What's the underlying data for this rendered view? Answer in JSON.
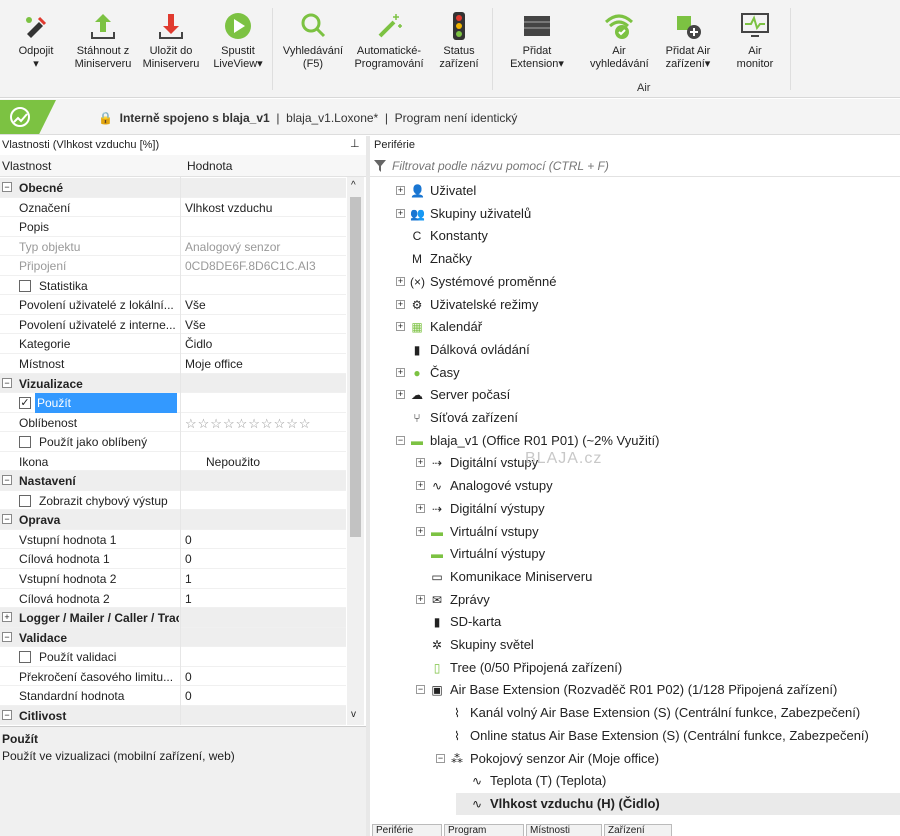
{
  "ribbon": {
    "buttons": [
      {
        "id": "odpojit",
        "label": "Odpojit\n▾",
        "icon": "plug-icon"
      },
      {
        "id": "stahnout",
        "label": "Stáhnout z\nMiniserveru",
        "icon": "upload-icon"
      },
      {
        "id": "ulozit",
        "label": "Uložit do\nMiniserveru",
        "icon": "download-icon"
      },
      {
        "id": "liveview",
        "label": "Spustit\nLiveView▾",
        "icon": "play-icon"
      },
      {
        "id": "vyhledavani",
        "label": "Vyhledávání\n(F5)",
        "icon": "search-icon"
      },
      {
        "id": "autoprog",
        "label": "Automatické-\nProgramování",
        "icon": "magic-wand-icon"
      },
      {
        "id": "status",
        "label": "Status\nzařízení",
        "icon": "traffic-light-icon"
      },
      {
        "id": "pridat-ext",
        "label": "Přidat\nExtension▾",
        "icon": "extension-icon"
      },
      {
        "id": "air-vyhl",
        "label": "Air\nvyhledávání",
        "icon": "wifi-check-icon"
      },
      {
        "id": "pridat-air",
        "label": "Přidat Air\nzařízení▾",
        "icon": "puzzle-add-icon"
      },
      {
        "id": "air-monitor",
        "label": "Air\nmonitor",
        "icon": "monitor-icon"
      }
    ],
    "group_label": "Air"
  },
  "status": {
    "connected": "Interně spojeno s blaja_v1",
    "file": "blaja_v1.Loxone*",
    "program": "Program není identický"
  },
  "left": {
    "title": "Vlastnosti (Vlhkost vzduchu [%])",
    "col_key": "Vlastnost",
    "col_val": "Hodnota",
    "rows": [
      {
        "type": "sec",
        "k": "Obecné"
      },
      {
        "k": "Označení",
        "v": "Vlhkost vzduchu"
      },
      {
        "k": "Popis",
        "v": ""
      },
      {
        "k": "Typ objektu",
        "v": "Analogový senzor",
        "dis": true
      },
      {
        "k": "Připojení",
        "v": "0CD8DE6F.8D6C1C.AI3",
        "dis": true
      },
      {
        "k": "Statistika",
        "v": "",
        "cb": "unchecked"
      },
      {
        "k": "Povolení uživatelé z lokální...",
        "v": "Vše"
      },
      {
        "k": "Povolení uživatelé z interne...",
        "v": "Vše"
      },
      {
        "k": "Kategorie",
        "v": "Čidlo"
      },
      {
        "k": "Místnost",
        "v": "Moje office"
      },
      {
        "type": "sec",
        "k": "Vizualizace"
      },
      {
        "k": "Použít",
        "v": "",
        "cb": "checked",
        "sel": true
      },
      {
        "k": "Oblíbenost",
        "v": "☆☆☆☆☆☆☆☆☆☆",
        "stars": true
      },
      {
        "k": "Použít jako oblíbený",
        "v": "",
        "cb": "unchecked"
      },
      {
        "k": "Ikona",
        "v": "Nepoužito",
        "vpad": true
      },
      {
        "type": "sec",
        "k": "Nastavení"
      },
      {
        "k": "Zobrazit chybový výstup",
        "v": "",
        "cb": "unchecked"
      },
      {
        "type": "sec",
        "k": "Oprava"
      },
      {
        "k": "Vstupní hodnota 1",
        "v": "0"
      },
      {
        "k": "Cílová hodnota 1",
        "v": "0"
      },
      {
        "k": "Vstupní hodnota 2",
        "v": "1"
      },
      {
        "k": "Cílová hodnota 2",
        "v": "1"
      },
      {
        "type": "sec",
        "k": "Logger / Mailer / Caller / Tracker",
        "collapsed": true
      },
      {
        "type": "sec",
        "k": "Validace"
      },
      {
        "k": "Použít validaci",
        "v": "",
        "cb": "unchecked"
      },
      {
        "k": "Překročení časového limitu...",
        "v": "0"
      },
      {
        "k": "Standardní hodnota",
        "v": "0"
      },
      {
        "type": "sec",
        "k": "Citlivost"
      }
    ],
    "desc_title": "Použít",
    "desc_text": "Použít ve vizualizaci (mobilní zařízení, web)"
  },
  "right": {
    "title": "Periférie",
    "filter_placeholder": "Filtrovat podle názvu pomocí (CTRL + F)",
    "tree": [
      {
        "lvl": 0,
        "ex": "+",
        "icon": "user-icon",
        "g": "👤",
        "t": "Uživatel"
      },
      {
        "lvl": 0,
        "ex": "+",
        "icon": "user-group-icon",
        "g": "👥",
        "t": "Skupiny uživatelů"
      },
      {
        "lvl": 0,
        "ex": "",
        "icon": "constant-icon",
        "g": "C",
        "t": "Konstanty"
      },
      {
        "lvl": 0,
        "ex": "",
        "icon": "marker-icon",
        "g": "M",
        "t": "Značky"
      },
      {
        "lvl": 0,
        "ex": "+",
        "icon": "variable-icon",
        "g": "(×)",
        "t": "Systémové proměnné"
      },
      {
        "lvl": 0,
        "ex": "+",
        "icon": "gear-icon",
        "g": "⚙",
        "t": "Uživatelské režimy"
      },
      {
        "lvl": 0,
        "ex": "+",
        "icon": "calendar-icon",
        "g": "▦",
        "t": "Kalendář"
      },
      {
        "lvl": 0,
        "ex": "",
        "icon": "remote-icon",
        "g": "▮",
        "t": "Dálková ovládání"
      },
      {
        "lvl": 0,
        "ex": "+",
        "icon": "clock-icon",
        "g": "●",
        "t": "Časy"
      },
      {
        "lvl": 0,
        "ex": "+",
        "icon": "weather-icon",
        "g": "☁",
        "t": "Server počasí"
      },
      {
        "lvl": 0,
        "ex": "",
        "icon": "network-icon",
        "g": "⑂",
        "t": "Síťová zařízení"
      },
      {
        "lvl": 0,
        "ex": "−",
        "icon": "miniserver-icon",
        "g": "▬",
        "t": "blaja_v1 (Office R01 P01) (~2% Využití)"
      },
      {
        "lvl": 1,
        "ex": "+",
        "icon": "digital-input-icon",
        "g": "⇢",
        "t": "Digitální vstupy"
      },
      {
        "lvl": 1,
        "ex": "+",
        "icon": "analog-input-icon",
        "g": "∿",
        "t": "Analogové vstupy"
      },
      {
        "lvl": 1,
        "ex": "+",
        "icon": "digital-output-icon",
        "g": "⇢",
        "t": "Digitální výstupy"
      },
      {
        "lvl": 1,
        "ex": "+",
        "icon": "virtual-input-icon",
        "g": "▬",
        "t": "Virtuální vstupy"
      },
      {
        "lvl": 1,
        "ex": "",
        "icon": "virtual-output-icon",
        "g": "▬",
        "t": "Virtuální výstupy"
      },
      {
        "lvl": 1,
        "ex": "",
        "icon": "communication-icon",
        "g": "▭",
        "t": "Komunikace Miniserveru"
      },
      {
        "lvl": 1,
        "ex": "+",
        "icon": "message-icon",
        "g": "✉",
        "t": "Zprávy"
      },
      {
        "lvl": 1,
        "ex": "",
        "icon": "sd-card-icon",
        "g": "▮",
        "t": "SD-karta"
      },
      {
        "lvl": 1,
        "ex": "",
        "icon": "light-group-icon",
        "g": "✲",
        "t": "Skupiny světel"
      },
      {
        "lvl": 1,
        "ex": "",
        "icon": "tree-icon",
        "g": "▯",
        "t": "Tree  (0/50 Připojená zařízení)"
      },
      {
        "lvl": 1,
        "ex": "−",
        "icon": "air-extension-icon",
        "g": "▣",
        "t": "Air Base Extension (Rozvaděč R01 P02) (1/128 Připojená zařízení)"
      },
      {
        "lvl": 2,
        "ex": "",
        "icon": "pulse-icon",
        "g": "⌇",
        "t": "Kanál volný Air Base Extension (S) (Centrální funkce, Zabezpečení)"
      },
      {
        "lvl": 2,
        "ex": "",
        "icon": "pulse-icon",
        "g": "⌇",
        "t": "Online status Air Base Extension (S) (Centrální funkce, Zabezpečení)"
      },
      {
        "lvl": 2,
        "ex": "−",
        "icon": "sensor-icon",
        "g": "⁂",
        "t": "Pokojový senzor Air (Moje office)"
      },
      {
        "lvl": 3,
        "ex": "",
        "icon": "analog-icon",
        "g": "∿",
        "t": "Teplota (T) (Teplota)"
      },
      {
        "lvl": 3,
        "ex": "",
        "icon": "analog-icon",
        "g": "∿",
        "t": "Vlhkost vzduchu (H) (Čidlo)",
        "sel": true
      }
    ],
    "watermark": "BLAJA.cz",
    "tabs": [
      "Periférie",
      "Program",
      "Místnosti",
      "Zařízení"
    ]
  },
  "colors": {
    "green": "#7cc242",
    "red": "#e03a2f",
    "selection": "#3399ff"
  }
}
